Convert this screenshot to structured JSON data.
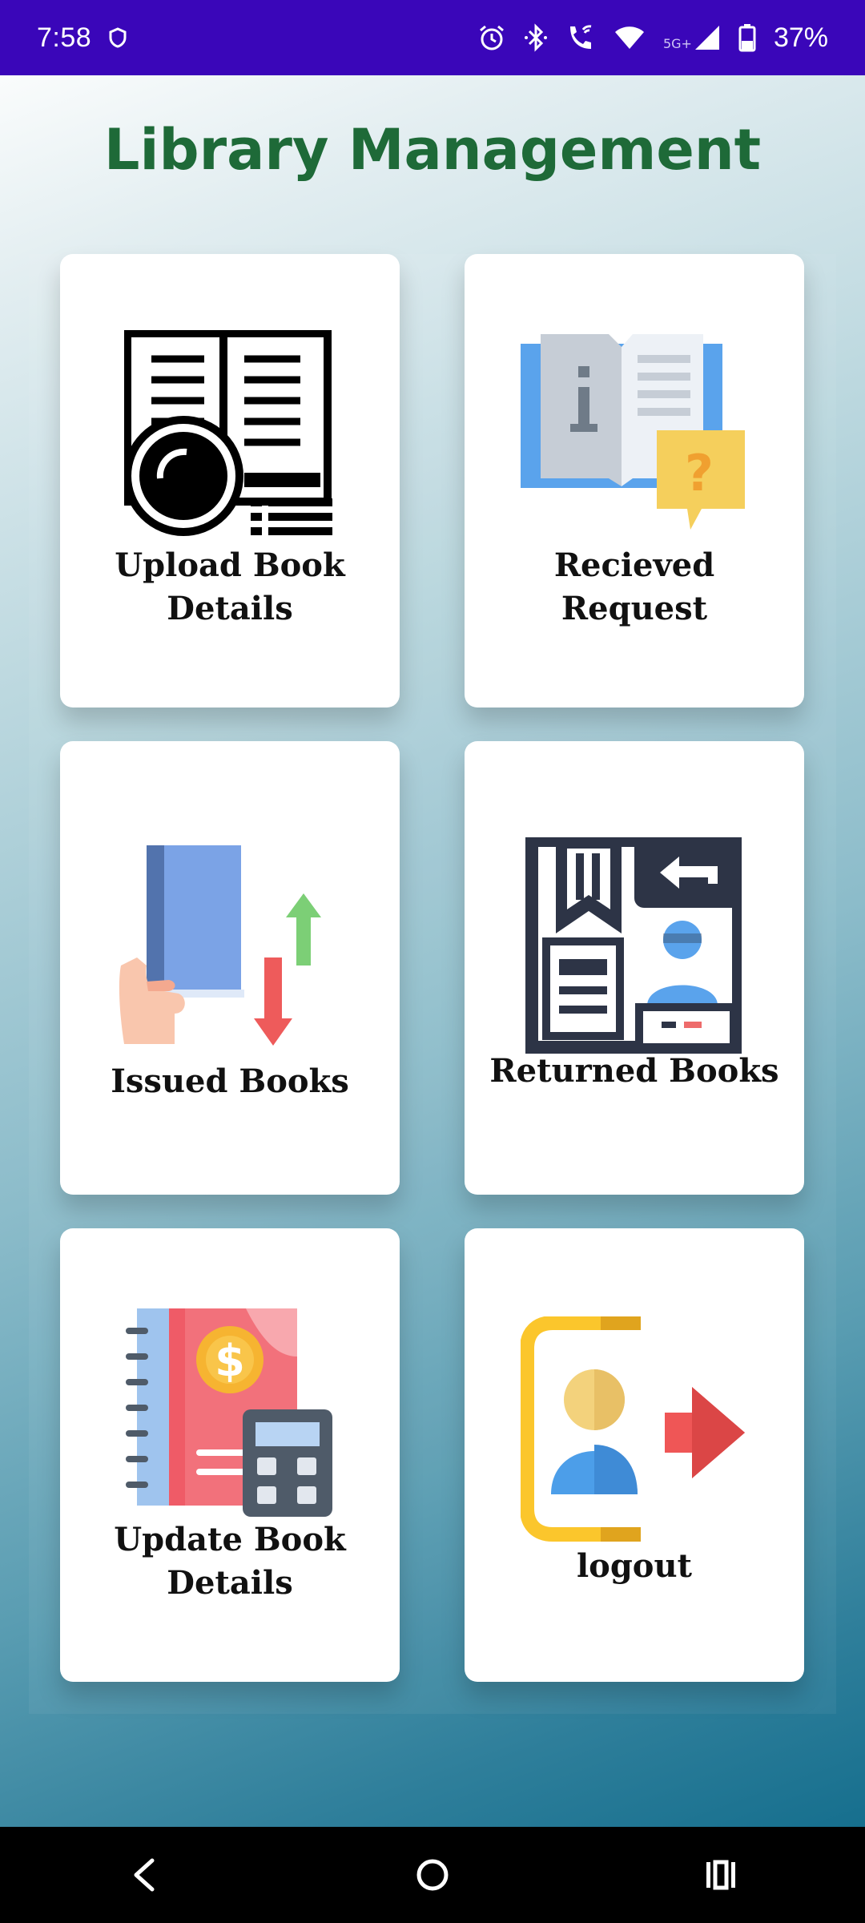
{
  "status_bar": {
    "time": "7:58",
    "battery": "37%",
    "network": "5G+",
    "icons": [
      "vpn-icon",
      "alarm-icon",
      "bluetooth-icon",
      "wifi-call-icon",
      "wifi-icon",
      "cellular-signal-icon",
      "battery-icon"
    ]
  },
  "header": {
    "title": "Library Management"
  },
  "colors": {
    "status_bar": "#3a06b9",
    "title": "#1e6a38",
    "card": "#ffffff"
  },
  "cards": [
    {
      "label_line1": "Upload Book",
      "label_line2": "Details",
      "icon": "open-book-magnifier-icon"
    },
    {
      "label_line1": "Recieved",
      "label_line2": "Request",
      "icon": "info-book-question-icon"
    },
    {
      "label": "Issued Books",
      "icon": "book-exchange-icon"
    },
    {
      "label": "Returned Books",
      "icon": "book-return-icon"
    },
    {
      "label_line1": "Update Book",
      "label_line2": "Details",
      "icon": "ledger-calculator-icon"
    },
    {
      "label": "logout",
      "icon": "logout-icon"
    }
  ],
  "nav": {
    "items": [
      "back-icon",
      "home-icon",
      "recents-icon"
    ]
  }
}
